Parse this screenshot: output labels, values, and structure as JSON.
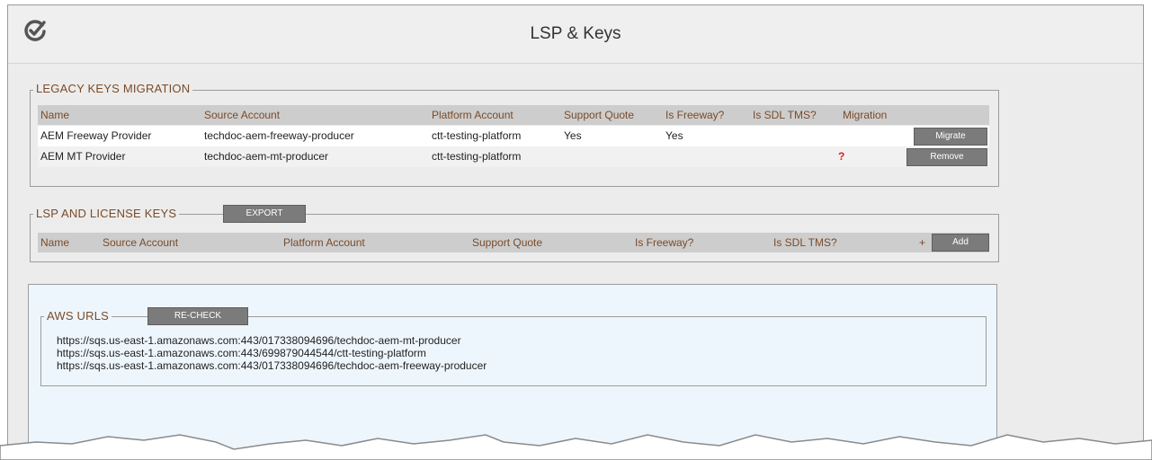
{
  "header": {
    "title": "LSP & Keys"
  },
  "legacy": {
    "legend": "LEGACY KEYS MIGRATION",
    "columns": [
      "Name",
      "Source Account",
      "Platform Account",
      "Support Quote",
      "Is Freeway?",
      "Is SDL TMS?",
      "Migration"
    ],
    "rows": [
      {
        "name": "AEM Freeway Provider",
        "source": "techdoc-aem-freeway-producer",
        "platform": "ctt-testing-platform",
        "support_quote": "Yes",
        "freeway": "Yes",
        "sdl": "",
        "migration": "",
        "action": "Migrate"
      },
      {
        "name": "AEM MT Provider",
        "source": "techdoc-aem-mt-producer",
        "platform": "ctt-testing-platform",
        "support_quote": "",
        "freeway": "",
        "sdl": "",
        "migration": "?",
        "action": "Remove"
      }
    ]
  },
  "lsp": {
    "legend": "LSP AND LICENSE KEYS",
    "export_label": "EXPORT",
    "columns": [
      "Name",
      "Source Account",
      "Platform Account",
      "Support Quote",
      "Is Freeway?",
      "Is SDL TMS?"
    ],
    "plus": "+",
    "add_label": "Add"
  },
  "aws": {
    "legend": "AWS URLS",
    "recheck_label": "RE-CHECK",
    "urls": [
      "https://sqs.us-east-1.amazonaws.com:443/017338094696/techdoc-aem-mt-producer",
      "https://sqs.us-east-1.amazonaws.com:443/699879044544/ctt-testing-platform",
      "https://sqs.us-east-1.amazonaws.com:443/017338094696/techdoc-aem-freeway-producer"
    ]
  },
  "colors": {
    "legend": "#7a4b29",
    "button": "#7b7b7b",
    "warning": "#e02020",
    "aws_bg": "#eef6fd"
  }
}
